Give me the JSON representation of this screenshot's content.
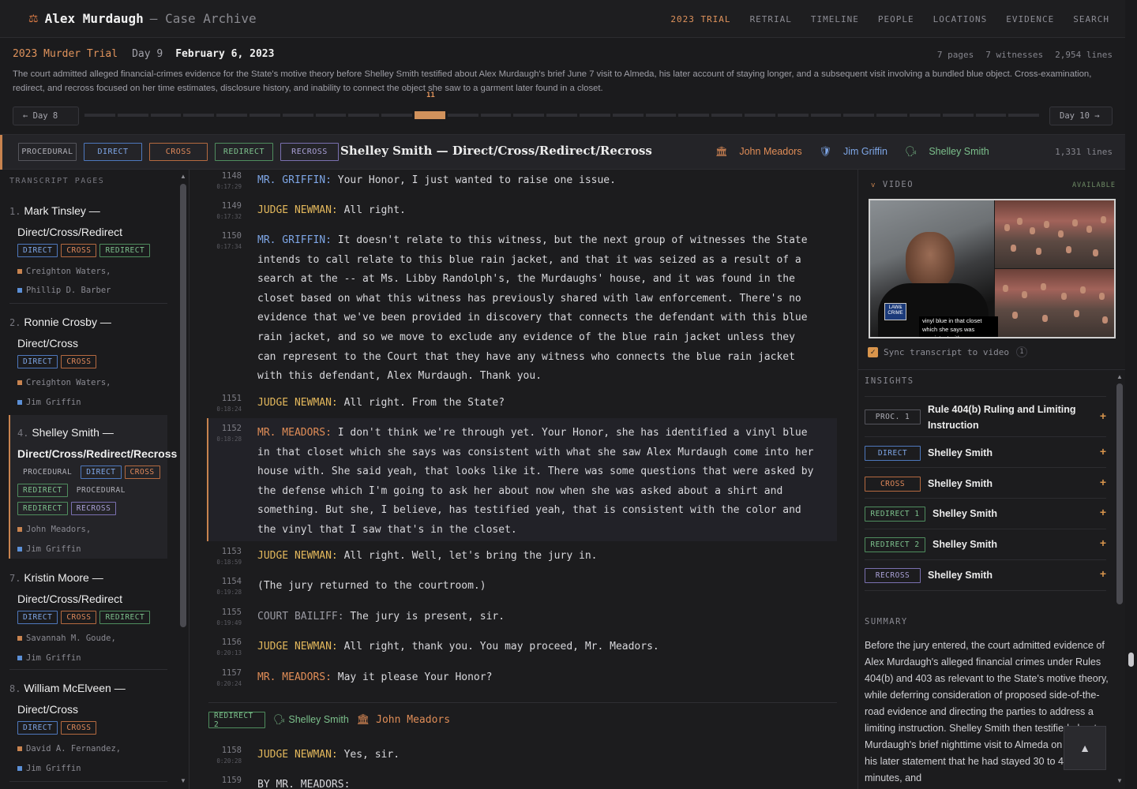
{
  "app": {
    "icon": "scale-icon",
    "title": "Alex Murdaugh",
    "subtitle": "— Case Archive"
  },
  "nav": [
    "2023 TRIAL",
    "RETRIAL",
    "TIMELINE",
    "PEOPLE",
    "LOCATIONS",
    "EVIDENCE",
    "SEARCH"
  ],
  "day": {
    "trial": "2023 Murder Trial",
    "day_label": "Day 9",
    "date": "February 6, 2023",
    "stats": [
      "7 pages",
      "7 witnesses",
      "2,954 lines"
    ],
    "description": "The court admitted alleged financial-crimes evidence for the State's motive theory before Shelley Smith testified about Alex Murdaugh's brief June 7 visit to Almeda, his later account of staying longer, and a subsequent visit involving a bundled blue object. Cross-examination, redirect, and recross focused on her time estimates, disclosure history, and inability to connect the object she saw to a garment later found in a closet.",
    "prev": "← Day 8",
    "next": "Day 10 →",
    "segment_label": "11",
    "segments_total": 29,
    "current_segment": 11
  },
  "witness_bar": {
    "tags": [
      "PROCEDURAL",
      "DIRECT",
      "CROSS",
      "REDIRECT",
      "RECROSS"
    ],
    "title": "Shelley Smith — Direct/Cross/Redirect/Recross",
    "prosecutor": "John Meadors",
    "defense": "Jim Griffin",
    "witness": "Shelley Smith",
    "lines": "1,331 lines"
  },
  "sidebar": {
    "header": "TRANSCRIPT PAGES",
    "items": [
      {
        "num": "1.",
        "name": "Mark Tinsley —",
        "name2": "Direct/Cross/Redirect",
        "tags": [
          "DIRECT",
          "CROSS",
          "REDIRECT"
        ],
        "people": [
          "Creighton Waters,",
          "Phillip D. Barber"
        ]
      },
      {
        "num": "2.",
        "name": "Ronnie Crosby —",
        "name2": "Direct/Cross",
        "tags": [
          "DIRECT",
          "CROSS"
        ],
        "people": [
          "Creighton Waters,",
          "Jim Griffin"
        ]
      },
      {
        "num": "4.",
        "name": "Shelley Smith —",
        "name2": "Direct/Cross/Redirect/Recross",
        "tags": [
          "PROCEDURAL",
          "DIRECT",
          "CROSS",
          "REDIRECT",
          "PROCEDURAL",
          "REDIRECT",
          "RECROSS"
        ],
        "people": [
          "John Meadors,",
          "Jim Griffin"
        ]
      },
      {
        "num": "7.",
        "name": "Kristin Moore —",
        "name2": "Direct/Cross/Redirect",
        "tags": [
          "DIRECT",
          "CROSS",
          "REDIRECT"
        ],
        "people": [
          "Savannah M. Goude,",
          "Jim Griffin"
        ]
      },
      {
        "num": "8.",
        "name": "William McElveen —",
        "name2": "Direct/Cross",
        "tags": [
          "DIRECT",
          "CROSS"
        ],
        "people": [
          "David A. Fernandez,",
          "Jim Griffin"
        ]
      }
    ]
  },
  "transcript": [
    {
      "ln": "1148",
      "ts": "0:17:29",
      "speaker": "MR. GRIFFIN:",
      "role": "def",
      "text": "Your Honor, I just wanted to raise one issue."
    },
    {
      "ln": "1149",
      "ts": "0:17:32",
      "speaker": "JUDGE NEWMAN:",
      "role": "judge",
      "text": "All right."
    },
    {
      "ln": "1150",
      "ts": "0:17:34",
      "speaker": "MR. GRIFFIN:",
      "role": "def",
      "text": "It doesn't relate to this witness, but the next group of witnesses the State intends to call relate to this blue rain jacket, and that it was seized as a result of a search at the -- at Ms. Libby Randolph's, the Murdaughs' house, and it was found in the closet based on what this witness has previously shared with law enforcement. There's no evidence that we've been provided in discovery that connects the defendant with this blue rain jacket, and so we move to exclude any evidence of the blue rain jacket unless they can represent to the Court that they have any witness who connects the blue rain jacket with this defendant, Alex Murdaugh. Thank you."
    },
    {
      "ln": "1151",
      "ts": "0:18:24",
      "speaker": "JUDGE NEWMAN:",
      "role": "judge",
      "text": "All right. From the State?"
    },
    {
      "ln": "1152",
      "ts": "0:18:28",
      "speaker": "MR. MEADORS:",
      "role": "pros",
      "text": "I don't think we're through yet. Your Honor, she has identified a vinyl blue in that closet which she says was consistent with what she saw Alex Murdaugh come into her house with. She said yeah, that looks like it. There was some questions that were asked by the defense which I'm going to ask her about now when she was asked about a shirt and something. But she, I believe, has testified yeah, that is consistent with the color and the vinyl that I saw that's in the closet."
    },
    {
      "ln": "1153",
      "ts": "0:18:59",
      "speaker": "JUDGE NEWMAN:",
      "role": "judge",
      "text": "All right. Well, let's bring the jury in."
    },
    {
      "ln": "1154",
      "ts": "0:19:28",
      "speaker": "",
      "role": "other",
      "text": "(The jury returned to the courtroom.)"
    },
    {
      "ln": "1155",
      "ts": "0:19:49",
      "speaker": "COURT BAILIFF:",
      "role": "other",
      "text": "The jury is present, sir."
    },
    {
      "ln": "1156",
      "ts": "0:20:13",
      "speaker": "JUDGE NEWMAN:",
      "role": "judge",
      "text": "All right, thank you. You may proceed, Mr. Meadors."
    },
    {
      "ln": "1157",
      "ts": "0:20:24",
      "speaker": "MR. MEADORS:",
      "role": "pros",
      "text": "May it please Your Honor?"
    },
    {
      "ln": "1158",
      "ts": "0:20:28",
      "speaker": "JUDGE NEWMAN:",
      "role": "judge",
      "text": "Yes, sir."
    },
    {
      "ln": "1159",
      "ts": "",
      "speaker": "",
      "role": "other",
      "text": "BY MR. MEADORS:"
    }
  ],
  "section2": {
    "tag": "REDIRECT 2",
    "witness": "Shelley Smith",
    "prosecutor": "John Meadors"
  },
  "video": {
    "header": "VIDEO",
    "status": "AVAILABLE",
    "logo_text": "LAW& CRIME",
    "caption": "vinyl blue in that closet which she says was consistent with",
    "sync_label": "Sync transcript to video",
    "sync_count": "1"
  },
  "insights": {
    "header": "INSIGHTS",
    "items": [
      {
        "tag": "PROC. 1",
        "label": "Rule 404(b) Ruling and Limiting Instruction"
      },
      {
        "tag": "DIRECT",
        "label": "Shelley Smith"
      },
      {
        "tag": "CROSS",
        "label": "Shelley Smith"
      },
      {
        "tag": "REDIRECT 1",
        "label": "Shelley Smith"
      },
      {
        "tag": "REDIRECT 2",
        "label": "Shelley Smith"
      },
      {
        "tag": "RECROSS",
        "label": "Shelley Smith"
      }
    ]
  },
  "summary": {
    "header": "SUMMARY",
    "text": "Before the jury entered, the court admitted evidence of Alex Murdaugh's alleged financial crimes under Rules 404(b) and 403 as relevant to the State's motive theory, while deferring consideration of proposed side-of-the-road evidence and directing the parties to address a limiting instruction. Shelley Smith then testified about Murdaugh's brief nighttime visit to Almeda on June 7, his later statement that he had stayed 30 to 40 minutes, and"
  },
  "colors": {
    "accent": "#c8834f",
    "direct": "#7ea6e6",
    "cross": "#e0895a",
    "redirect": "#7cc08c",
    "recross": "#a9a0d6",
    "judge": "#e3b85c"
  }
}
